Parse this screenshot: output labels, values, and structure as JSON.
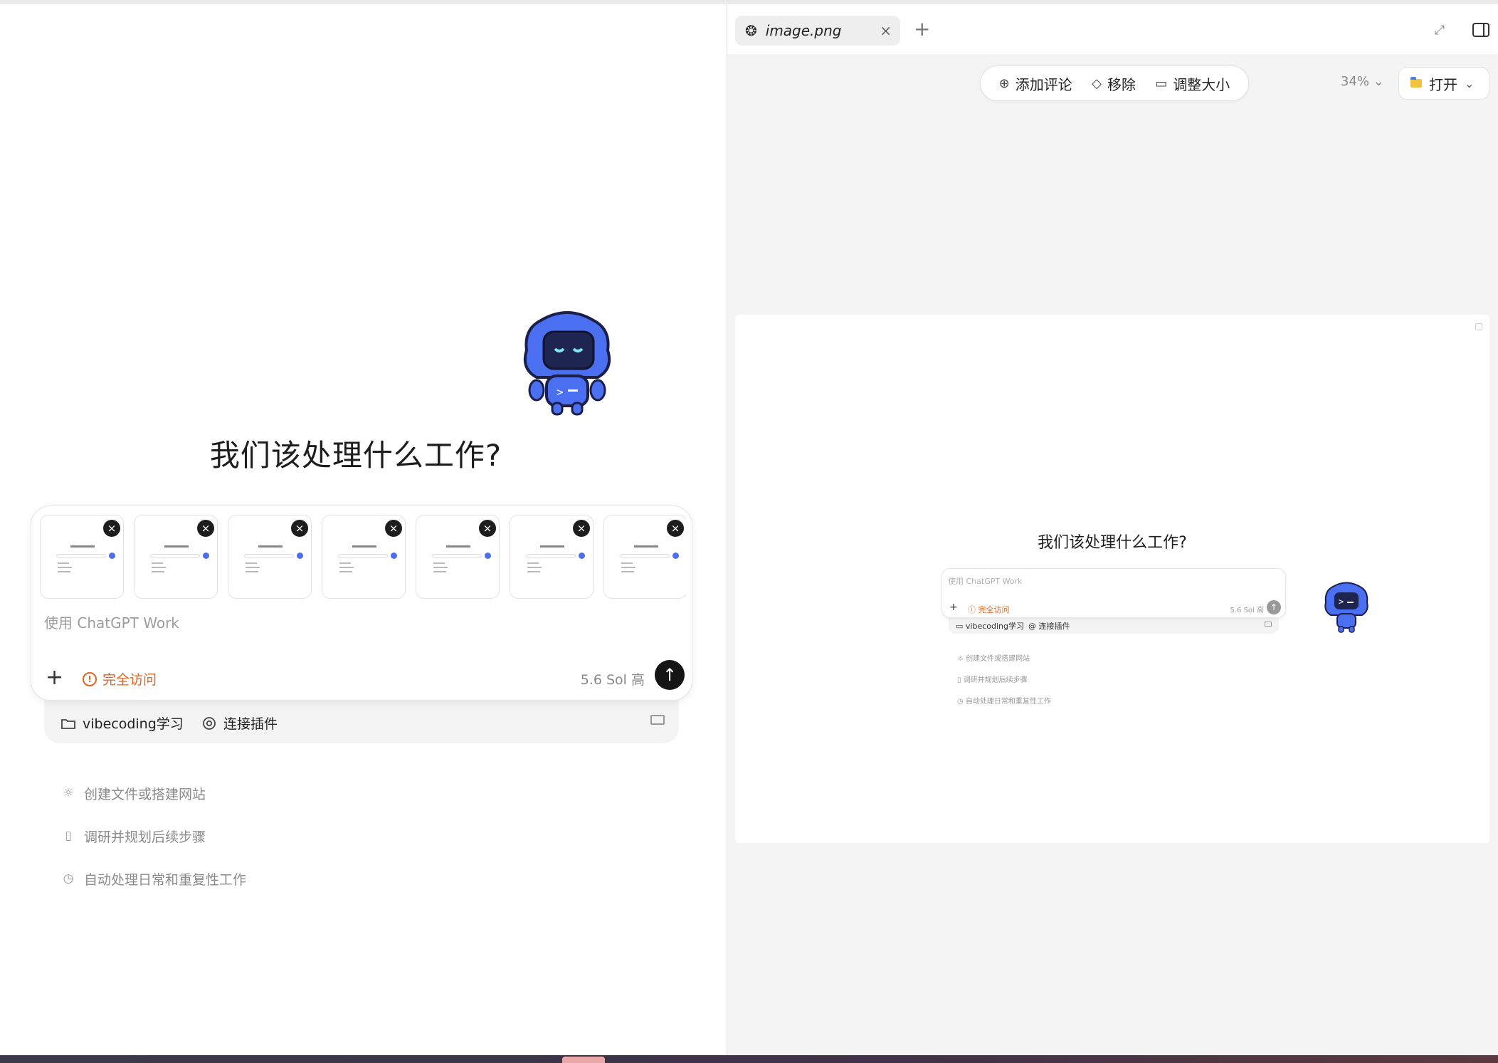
{
  "left": {
    "headline": "我们该处理什么工作?",
    "attachments": [
      {
        "remove": "×"
      },
      {
        "remove": "×"
      },
      {
        "remove": "×"
      },
      {
        "remove": "×"
      },
      {
        "remove": "×"
      },
      {
        "remove": "×"
      },
      {
        "remove": "×"
      }
    ],
    "composer": {
      "placeholder": "使用 ChatGPT Work",
      "add": "+",
      "access_label": "完全访问",
      "model_label": "5.6 Sol  高",
      "send": "↑"
    },
    "context": {
      "project": "vibecoding学习",
      "plugins": "连接插件"
    },
    "suggestions": [
      {
        "icon": "bulb-icon",
        "label": "创建文件或搭建网站"
      },
      {
        "icon": "book-icon",
        "label": "调研并规划后续步骤"
      },
      {
        "icon": "clock-icon",
        "label": "自动处理日常和重复性工作"
      }
    ]
  },
  "right": {
    "tab": {
      "name": "image.png",
      "close": "×"
    },
    "new_tab": "+",
    "toolbar": {
      "comment": "添加评论",
      "remove": "移除",
      "resize": "调整大小"
    },
    "zoom": "34%",
    "open_label": "打开",
    "preview": {
      "headline": "我们该处理什么工作?",
      "placeholder": "使用 ChatGPT Work",
      "access": "完全访问",
      "model": "5.6 Sol  高",
      "project": "vibecoding学习",
      "plugins": "连接插件",
      "suggestions": [
        "创建文件或搭建网站",
        "调研并规划后续步骤",
        "自动处理日常和重复性工作"
      ]
    }
  },
  "colors": {
    "accent_orange": "#e0641f",
    "mascot_blue": "#4a6ff0",
    "send_dark": "#151515"
  }
}
